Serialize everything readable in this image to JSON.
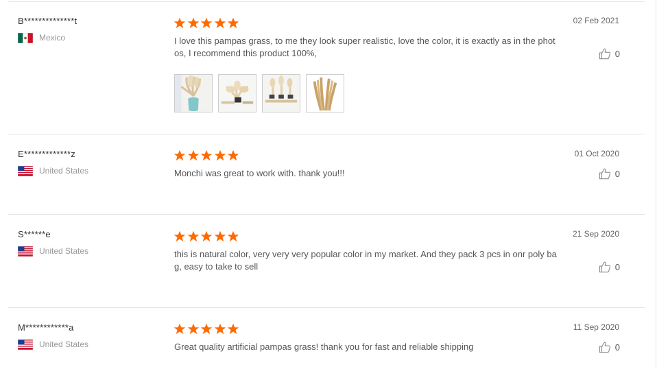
{
  "colors": {
    "star": "#ff6a00",
    "divider": "#e3e3e3",
    "muted_text": "#999999"
  },
  "reviews": [
    {
      "name": "B**************t",
      "country": "Mexico",
      "flag_icon": "mexico-flag-icon",
      "rating": 5,
      "text": "I love this pampas grass, to me they look super realistic, love the color, it is exactly as in the photos, I recommend this product 100%,",
      "date": "02 Feb 2021",
      "helpful_count": "0",
      "photos": [
        "review-photo-1",
        "review-photo-2",
        "review-photo-3",
        "review-photo-4"
      ]
    },
    {
      "name": "E*************z",
      "country": "United States",
      "flag_icon": "us-flag-icon",
      "rating": 5,
      "text": "Monchi was great to work with. thank you!!!",
      "date": "01 Oct 2020",
      "helpful_count": "0"
    },
    {
      "name": "S******e",
      "country": "United States",
      "flag_icon": "us-flag-icon",
      "rating": 5,
      "text": "this is natural color, very very very popular color in my market. And they pack 3 pcs in onr poly bag, easy to take to sell",
      "date": "21 Sep 2020",
      "helpful_count": "0"
    },
    {
      "name": "M************a",
      "country": "United States",
      "flag_icon": "us-flag-icon",
      "rating": 5,
      "text": "Great quality artificial pampas grass! thank you for fast and reliable shipping",
      "date": "11 Sep 2020",
      "helpful_count": "0"
    }
  ]
}
